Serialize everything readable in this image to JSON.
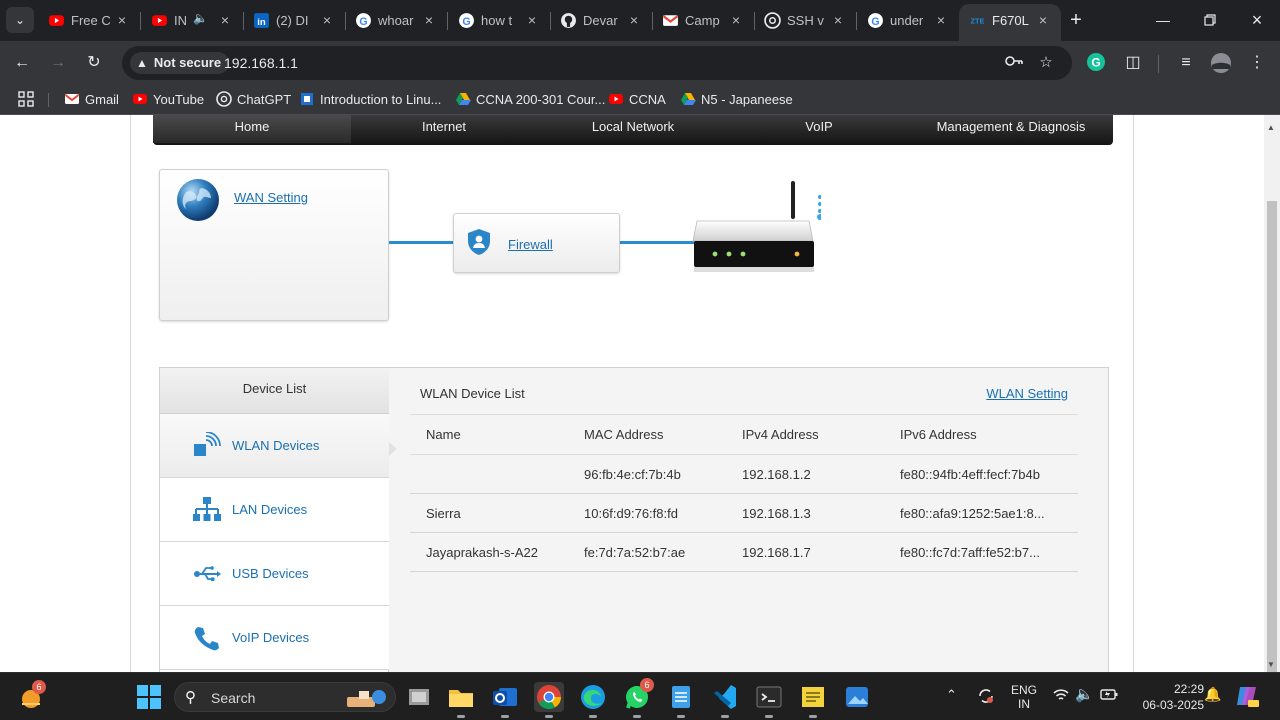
{
  "browser": {
    "tabs": [
      {
        "title": "Free C",
        "favicon": "youtube-icon"
      },
      {
        "title": "IN",
        "favicon": "youtube-icon",
        "audio": true
      },
      {
        "title": "(2) DI",
        "favicon": "linkedin-icon"
      },
      {
        "title": "whoar",
        "favicon": "google-icon"
      },
      {
        "title": "how t",
        "favicon": "google-icon"
      },
      {
        "title": "Devar",
        "favicon": "github-icon"
      },
      {
        "title": "Camp",
        "favicon": "gmail-icon"
      },
      {
        "title": "SSH v",
        "favicon": "chatgpt-icon"
      },
      {
        "title": "under",
        "favicon": "google-icon"
      },
      {
        "title": "F670L",
        "favicon": "zte-icon",
        "active": true
      }
    ],
    "security_label": "Not secure",
    "url": "192.168.1.1",
    "bookmarks": [
      "Gmail",
      "YouTube",
      "ChatGPT",
      "Introduction to Linu...",
      "CCNA 200-301 Cour...",
      "CCNA",
      "N5 - Japaneese"
    ],
    "zte_favicon_text": "ZTE"
  },
  "router_ui": {
    "nav": [
      "Home",
      "Internet",
      "Local Network",
      "VoIP",
      "Management & Diagnosis"
    ],
    "nav_active": "Home",
    "topology": {
      "wan_link": "WAN Setting",
      "firewall_link": "Firewall"
    },
    "device_list": {
      "heading": "Device List",
      "items": [
        "WLAN Devices",
        "LAN Devices",
        "USB Devices",
        "VoIP Devices"
      ],
      "selected": "WLAN Devices"
    },
    "wlan": {
      "title": "WLAN Device List",
      "setting_link": "WLAN Setting",
      "columns": [
        "Name",
        "MAC Address",
        "IPv4 Address",
        "IPv6 Address"
      ],
      "rows": [
        {
          "name": "",
          "mac": "96:fb:4e:cf:7b:4b",
          "ipv4": "192.168.1.2",
          "ipv6": "fe80::94fb:4eff:fecf:7b4b"
        },
        {
          "name": "Sierra",
          "mac": "10:6f:d9:76:f8:fd",
          "ipv4": "192.168.1.3",
          "ipv6": "fe80::afa9:1252:5ae1:8..."
        },
        {
          "name": "Jayaprakash-s-A22",
          "mac": "fe:7d:7a:52:b7:ae",
          "ipv4": "192.168.1.7",
          "ipv6": "fe80::fc7d:7aff:fe52:b7..."
        }
      ]
    }
  },
  "taskbar": {
    "search_label": "Search",
    "weather_badge": "6",
    "whatsapp_badge": "6",
    "lang_line1": "ENG",
    "lang_line2": "IN",
    "time": "22:29",
    "date": "06-03-2025"
  },
  "colors": {
    "link": "#1a6fb3",
    "pipe": "#2a8ccd",
    "chrome_bg": "#202124",
    "toolbar_bg": "#35363a"
  }
}
